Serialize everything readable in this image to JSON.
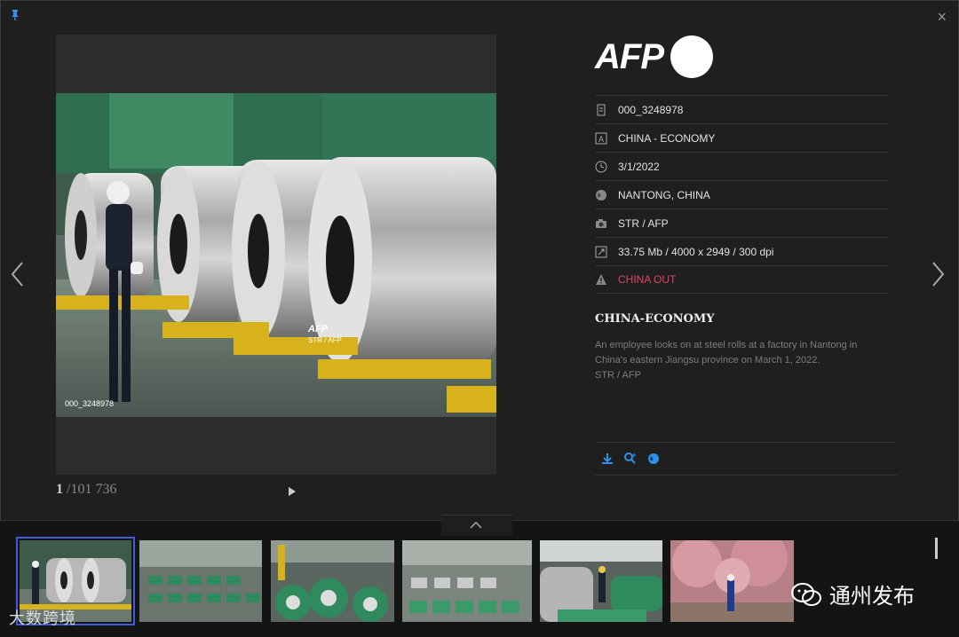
{
  "viewer": {
    "photo_id": "000_3248978",
    "watermark_logo": "AFP",
    "watermark_credit": "STR / AFP",
    "counter_current": "1",
    "counter_total": "/101 736"
  },
  "agency": {
    "logo_text": "AFP"
  },
  "meta": [
    {
      "icon": "document-icon",
      "text": "000_3248978"
    },
    {
      "icon": "category-icon",
      "text": "CHINA - ECONOMY"
    },
    {
      "icon": "clock-icon",
      "text": "3/1/2022"
    },
    {
      "icon": "globe-icon",
      "text": "NANTONG, CHINA"
    },
    {
      "icon": "camera-icon",
      "text": "STR / AFP"
    },
    {
      "icon": "resize-icon",
      "text": "33.75 Mb / 4000 x 2949 / 300 dpi"
    },
    {
      "icon": "warning-icon",
      "text": "CHINA OUT"
    }
  ],
  "story": {
    "headline": "CHINA-ECONOMY",
    "caption_line1": "An employee looks on at steel rolls at a factory in Nantong in China's eastern Jiangsu province on March 1, 2022.",
    "caption_line2": "STR / AFP"
  },
  "overlays": {
    "left_watermark": "大数跨境",
    "right_watermark": "通州发布"
  },
  "colors": {
    "warning": "#e0456a",
    "accent_blue": "#2f8fe6",
    "selected_thumb": "#3d5ed8"
  }
}
